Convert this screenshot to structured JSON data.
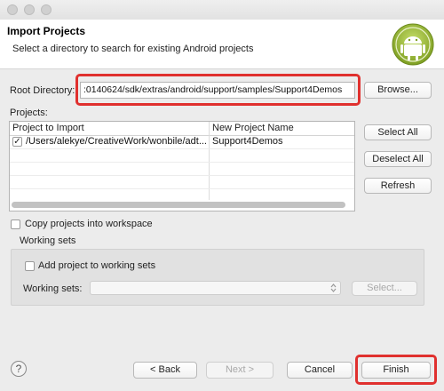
{
  "header": {
    "title": "Import Projects",
    "subtitle": "Select a directory to search for existing Android projects"
  },
  "root_dir": {
    "label": "Root Directory:",
    "value": ":0140624/sdk/extras/android/support/samples/Support4Demos",
    "browse_label": "Browse..."
  },
  "projects": {
    "label": "Projects:",
    "columns": [
      "Project to Import",
      "New Project Name"
    ],
    "rows": [
      {
        "checked": "✓",
        "path": "/Users/alekye/CreativeWork/wonbile/adt...",
        "name": "Support4Demos"
      }
    ],
    "select_all": "Select All",
    "deselect_all": "Deselect All",
    "refresh": "Refresh"
  },
  "copy_option": {
    "label": "Copy projects into workspace"
  },
  "working_sets": {
    "group_label": "Working sets",
    "add_label": "Add project to working sets",
    "sets_label": "Working sets:",
    "select_button": "Select..."
  },
  "footer": {
    "help": "?",
    "back": "< Back",
    "next": "Next >",
    "cancel": "Cancel",
    "finish": "Finish"
  },
  "colors": {
    "highlight": "#e0302e",
    "android_green": "#9fc23c"
  },
  "icons": [
    "help-icon",
    "android-logo-icon",
    "checkmark-icon",
    "chevron-updown-icon"
  ]
}
